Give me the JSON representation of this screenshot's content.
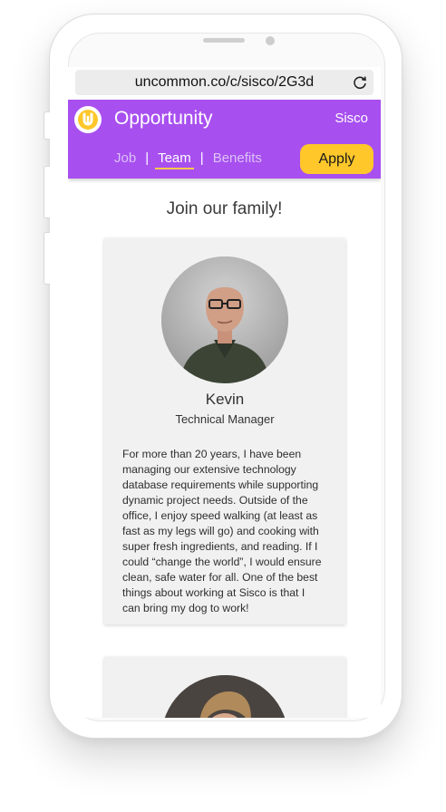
{
  "browser": {
    "url": "uncommon.co/c/sisco/2G3d",
    "reload_icon": "reload-icon"
  },
  "appbar": {
    "logo_icon": "uncommon-logo-icon",
    "title": "Opportunity",
    "company": "Sisco",
    "tabs": [
      {
        "label": "Job",
        "active": false
      },
      {
        "label": "Team",
        "active": true
      },
      {
        "label": "Benefits",
        "active": false
      }
    ],
    "apply_label": "Apply",
    "colors": {
      "bar": "#a84ff0",
      "apply": "#ffc72a",
      "underline": "#ffc94d"
    }
  },
  "team": {
    "heading": "Join our family!",
    "members": [
      {
        "name": "Kevin",
        "role": "Technical Manager",
        "bio_lines": [
          "For more than 20 years, I have been",
          "managing our extensive technology",
          "database requirements while supporting",
          "dynamic project needs. Outside of the",
          "office, I enjoy speed walking (at least as",
          "fast as my legs will go) and cooking with",
          "super fresh ingredients, and reading. If I",
          "could “change the world”, I would ensure",
          "clean, safe water for all. One of the best",
          "things about working at Sisco is that I",
          "can bring my dog to work!"
        ]
      }
    ]
  }
}
